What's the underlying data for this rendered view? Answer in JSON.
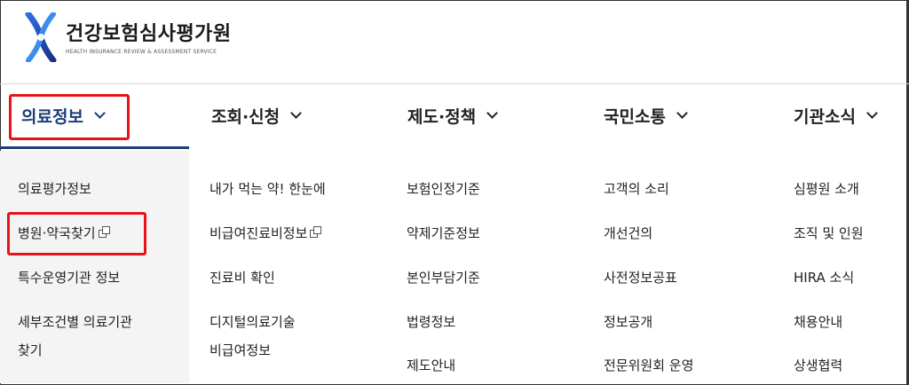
{
  "header": {
    "logo_title": "건강보험심사평가원",
    "logo_subtitle": "HEALTH INSURANCE REVIEW & ASSESSMENT SERVICE",
    "logo_icon": "hira-emblem-icon",
    "brand_colors": {
      "navy": "#1c3f7a",
      "blue": "#2a5bd7",
      "highlight_red": "#e5141b"
    }
  },
  "nav": {
    "items": [
      {
        "label": "의료정보",
        "active": true
      },
      {
        "label": "조회·신청"
      },
      {
        "label": "제도·정책"
      },
      {
        "label": "국민소통"
      },
      {
        "label": "기관소식"
      }
    ],
    "chevron_icon": "chevron-down-icon"
  },
  "submenu": {
    "col1": [
      "의료평가정보",
      "병원·약국찾기",
      "특수운영기관 정보",
      "세부조건별 의료기관",
      "찾기"
    ],
    "col2": [
      "내가 먹는 약! 한눈에",
      "비급여진료비정보",
      "진료비 확인",
      "디지털의료기술",
      "비급여정보"
    ],
    "col3": [
      "보험인정기준",
      "약제기준정보",
      "본인부담기준",
      "법령정보",
      "제도안내"
    ],
    "col4": [
      "고객의 소리",
      "개선건의",
      "사전정보공표",
      "정보공개",
      "전문위원회 운영"
    ],
    "col5": [
      "심평원 소개",
      "조직 및 인원",
      "HIRA 소식",
      "채용안내",
      "상생협력"
    ],
    "external_link_icon": "external-link-icon"
  }
}
